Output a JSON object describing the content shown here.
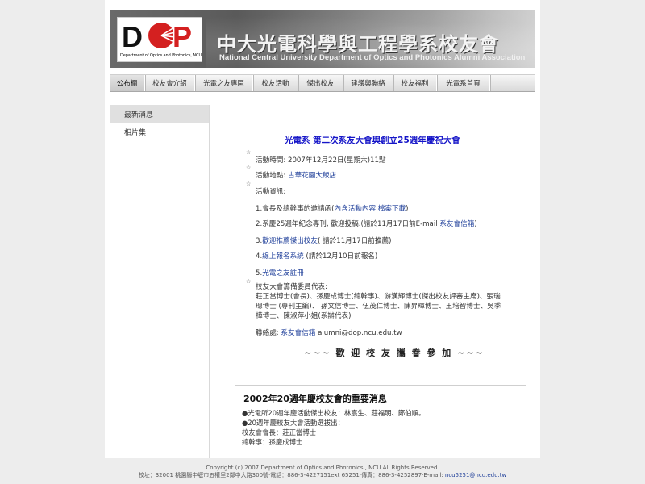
{
  "banner": {
    "logo_text": "DOP",
    "logo_sub": "Department of Optics and Photonics, NCU",
    "title_zh": "中大光電科學與工程學系校友會",
    "title_en": "National Central University Department of Optics and  Photonics Alumni Association"
  },
  "nav": [
    {
      "label": "公布欄",
      "active": true
    },
    {
      "label": "校友會介紹"
    },
    {
      "label": "光電之友專區"
    },
    {
      "label": "校友活動"
    },
    {
      "label": "傑出校友"
    },
    {
      "label": "建議與聯絡"
    },
    {
      "label": "校友福利"
    },
    {
      "label": "光電系首頁"
    }
  ],
  "sidebar": [
    {
      "label": "最新消息",
      "active": true
    },
    {
      "label": "相片集"
    }
  ],
  "event": {
    "title": "光電系 第二次系友大會與創立25週年慶祝大會",
    "time_label": "活動時間: 2007年12月22日(星期六)11點",
    "place_label": "活動地點: ",
    "place_link": "古華花園大飯店",
    "info_label": "活動資訊:",
    "item1_pre": "1.會長及總幹事的邀請函(",
    "item1_link": "內含活動內容,檔案下載",
    "item1_post": ")",
    "item2_pre": "2.系慶25週年紀念專刊, 歡迎投稿.(請於11月17日前E-mail ",
    "item2_link": "系友會信箱",
    "item2_post": ")",
    "item3_pre": "3.",
    "item3_link": "歡迎推薦傑出校友",
    "item3_post": "( 請於11月17日前推薦)",
    "item4_pre": "4.",
    "item4_link": "線上報名系統",
    "item4_post": " (請於12月10日前報名)",
    "item5_pre": "5.",
    "item5_link": "光電之友註冊",
    "committee_label": "校友大會籌備委員代表:",
    "committee_l1": "莊正當博士(會長)、孫慶成博士(總幹事)、游漢輝博士(傑出校友評審主席)、張瑞",
    "committee_l2": "璁博士 (專刊主編)、 孫文信博士、伍茂仁博士、陳昇暉博士、王培智博士、吳季",
    "committee_l3": "樺博士、陳淑萍小姐(系辦代表)",
    "contact_label": "聯絡處: ",
    "contact_link": "系友會信箱",
    "contact_email": " alumni@dop.ncu.edu.tw",
    "welcome": "~~~ 歡 迎 校 友 攜 眷 參 加 ~~~"
  },
  "anniversary": {
    "title": "2002年20週年慶校友會的重要消息",
    "line1": "●光電所20週年慶活動傑出校友：林宸生、莊福明、鄭伯順。",
    "line2": "●20週年慶校友大會活動選拔出：",
    "line3": "校友會會長：莊正當博士",
    "line4": "總幹事：孫慶成博士"
  },
  "footer": {
    "copyright": "Copyright (c) 2007 Department of Optics and Photonics , NCU All Rights Reserved.",
    "address": "校址：32001 桃園縣中壢市五權里2鄰中大路300號·電話：886-3-4227151ext 65251·傳真：886-3-4252897·E-mail: ",
    "email": "ncu5251@ncu.edu.tw"
  },
  "colors": {
    "title_blue": "#1515c8",
    "link_blue": "#1f3f9a",
    "logo_red": "#d42020"
  }
}
